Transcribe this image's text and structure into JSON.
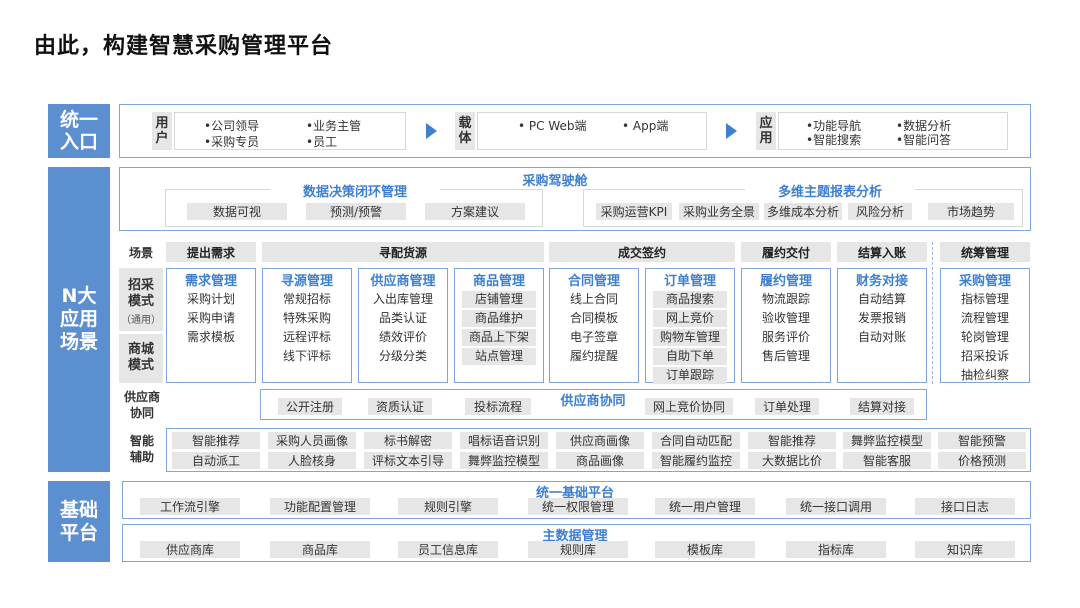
{
  "title": "由此，构建智慧采购管理平台",
  "bands": {
    "entry": "统一入口",
    "scenes": "N大应用场景",
    "base": "基础平台"
  },
  "entry": {
    "user_label": "用户",
    "users": [
      "•公司领导",
      "•业务主管",
      "•采购专员",
      "•员工"
    ],
    "carrier_label": "载体",
    "carriers": [
      "• PC Web端",
      "• App端"
    ],
    "app_label": "应用",
    "apps": [
      "•功能导航",
      "•数据分析",
      "•智能搜索",
      "•智能问答"
    ]
  },
  "cockpit": {
    "title": "采购驾驶舱",
    "left_title": "数据决策闭环管理",
    "left_items": [
      "数据可视",
      "预测/预警",
      "方案建议"
    ],
    "right_title": "多维主题报表分析",
    "right_items": [
      "采购运营KPI",
      "采购业务全景",
      "多维成本分析",
      "风险分析",
      "市场趋势"
    ]
  },
  "scenes": {
    "scene_label": "场景",
    "headers": [
      "提出需求",
      "寻配货源",
      "成交签约",
      "履约交付",
      "结算入账",
      "统筹管理"
    ],
    "mode1": "招采模式",
    "mode1_sub": "（通用）",
    "mode2": "商城模式",
    "columns": [
      {
        "title": "需求管理",
        "items": [
          {
            "t": "采购计划",
            "g": false
          },
          {
            "t": "采购申请",
            "g": false
          },
          {
            "t": "需求模板",
            "g": false
          }
        ]
      },
      {
        "title": "寻源管理",
        "items": [
          {
            "t": "常规招标",
            "g": false
          },
          {
            "t": "特殊采购",
            "g": false
          },
          {
            "t": "远程评标",
            "g": false
          },
          {
            "t": "线下评标",
            "g": false
          }
        ]
      },
      {
        "title": "供应商管理",
        "items": [
          {
            "t": "入出库管理",
            "g": false
          },
          {
            "t": "品类认证",
            "g": false
          },
          {
            "t": "绩效评价",
            "g": false
          },
          {
            "t": "分级分类",
            "g": false
          }
        ]
      },
      {
        "title": "商品管理",
        "items": [
          {
            "t": "店铺管理",
            "g": true
          },
          {
            "t": "商品维护",
            "g": true
          },
          {
            "t": "商品上下架",
            "g": true
          },
          {
            "t": "站点管理",
            "g": true
          }
        ]
      },
      {
        "title": "合同管理",
        "items": [
          {
            "t": "线上合同",
            "g": false
          },
          {
            "t": "合同模板",
            "g": false
          },
          {
            "t": "电子签章",
            "g": false
          },
          {
            "t": "履约提醒",
            "g": false
          }
        ]
      },
      {
        "title": "订单管理",
        "items": [
          {
            "t": "商品搜索",
            "g": true
          },
          {
            "t": "网上竞价",
            "g": true
          },
          {
            "t": "购物车管理",
            "g": true
          },
          {
            "t": "自助下单",
            "g": true
          },
          {
            "t": "订单跟踪",
            "g": true
          }
        ]
      },
      {
        "title": "履约管理",
        "items": [
          {
            "t": "物流跟踪",
            "g": false
          },
          {
            "t": "验收管理",
            "g": false
          },
          {
            "t": "服务评价",
            "g": false
          },
          {
            "t": "售后管理",
            "g": false
          }
        ]
      },
      {
        "title": "财务对接",
        "items": [
          {
            "t": "自动结算",
            "g": false
          },
          {
            "t": "发票报销",
            "g": false
          },
          {
            "t": "自动对账",
            "g": false
          }
        ]
      },
      {
        "title": "采购管理",
        "items": [
          {
            "t": "指标管理",
            "g": false
          },
          {
            "t": "流程管理",
            "g": false
          },
          {
            "t": "轮岗管理",
            "g": false
          },
          {
            "t": "招采投诉",
            "g": false
          },
          {
            "t": "抽检纠察",
            "g": false
          }
        ]
      }
    ],
    "supplier_label": "供应商协同",
    "supplier_title": "供应商协同",
    "supplier_items": [
      "公开注册",
      "资质认证",
      "投标流程",
      "网上竞价协同",
      "订单处理",
      "结算对接"
    ],
    "ai_label": "智能辅助",
    "ai_row1": [
      "智能推荐",
      "采购人员画像",
      "标书解密",
      "唱标语音识别",
      "供应商画像",
      "合同自动匹配",
      "智能推荐",
      "舞弊监控模型",
      "智能预警"
    ],
    "ai_row2": [
      "自动派工",
      "人脸核身",
      "评标文本引导",
      "舞弊监控模型",
      "商品画像",
      "智能履约监控",
      "大数据比价",
      "智能客服",
      "价格预测"
    ]
  },
  "base": {
    "unified_title": "统一基础平台",
    "unified_items": [
      "工作流引擎",
      "功能配置管理",
      "规则引擎",
      "统一权限管理",
      "统一用户管理",
      "统一接口调用",
      "接口日志"
    ],
    "master_title": "主数据管理",
    "master_items": [
      "供应商库",
      "商品库",
      "员工信息库",
      "规则库",
      "模板库",
      "指标库",
      "知识库"
    ]
  },
  "colors": {
    "band": "#5b8fd0",
    "accent": "#3f7fd0",
    "frame": "#7fa6d6",
    "gray_fill": "#e6e6e6"
  }
}
